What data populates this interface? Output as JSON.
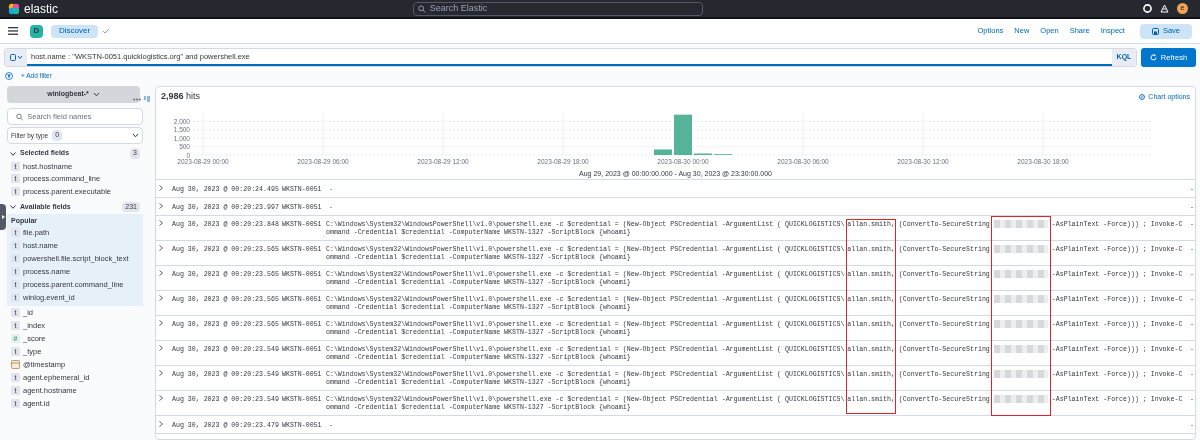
{
  "top_bar": {
    "brand": "elastic",
    "search_placeholder": "Search Elastic",
    "avatar": "e"
  },
  "app_bar": {
    "space": "D",
    "breadcrumb": "Discover",
    "actions": [
      "Options",
      "New",
      "Open",
      "Share",
      "Inspect"
    ],
    "save": "Save"
  },
  "query": {
    "value": "host.name : \"WKSTN-0051.quicklogistics.org\" and powershell.exe",
    "language": "KQL",
    "refresh": "Refresh"
  },
  "add_filter": "+ Add filter",
  "sidebar": {
    "index_pattern": "winlogbeat-*",
    "search_placeholder": "Search field names",
    "filter_by_type": "Filter by type",
    "filter_count": "0",
    "selected_header": "Selected fields",
    "selected_count": "3",
    "selected_fields": [
      {
        "name": "host.hostname",
        "kind": "string",
        "icon": "t"
      },
      {
        "name": "process.command_line",
        "kind": "string",
        "icon": "t"
      },
      {
        "name": "process.parent.executable",
        "kind": "string",
        "icon": "t"
      }
    ],
    "available_header": "Available fields",
    "available_count": "231",
    "popular_header": "Popular",
    "popular_fields": [
      {
        "name": "file.path",
        "kind": "string",
        "icon": "t"
      },
      {
        "name": "host.name",
        "kind": "string",
        "icon": "t"
      },
      {
        "name": "powershell.file.script_block_text",
        "kind": "string",
        "icon": "t"
      },
      {
        "name": "process.name",
        "kind": "string",
        "icon": "t"
      },
      {
        "name": "process.parent.command_line",
        "kind": "string",
        "icon": "t"
      },
      {
        "name": "winlog.event_id",
        "kind": "string",
        "icon": "t"
      }
    ],
    "other_fields": [
      {
        "name": "_id",
        "kind": "string",
        "icon": "t"
      },
      {
        "name": "_index",
        "kind": "string",
        "icon": "t"
      },
      {
        "name": "_score",
        "kind": "number",
        "icon": "#"
      },
      {
        "name": "_type",
        "kind": "string",
        "icon": "t"
      },
      {
        "name": "@timestamp",
        "kind": "date"
      },
      {
        "name": "agent.ephemeral_id",
        "kind": "string",
        "icon": "t"
      },
      {
        "name": "agent.hostname",
        "kind": "string",
        "icon": "t"
      },
      {
        "name": "agent.id",
        "kind": "string",
        "icon": "t"
      }
    ]
  },
  "hits": {
    "count": "2,986",
    "label": "hits"
  },
  "chart_options": "Chart options",
  "histogram": {
    "time_range": "Aug 29, 2023 @ 00:00:00.000 - Aug 30, 2023 @ 23:30:00.000",
    "chart_data": {
      "type": "bar",
      "grid": true,
      "categories": [
        "2023-08-29 00:00",
        null,
        null,
        null,
        null,
        null,
        "2023-08-29 06:00",
        null,
        null,
        null,
        null,
        null,
        "2023-08-29 12:00",
        null,
        null,
        null,
        null,
        null,
        "2023-08-29 18:00",
        null,
        null,
        null,
        null,
        null,
        "2023-08-30 00:00",
        null,
        null,
        null,
        null,
        null,
        "2023-08-30 06:00",
        null,
        null,
        null,
        null,
        null,
        "2023-08-30 12:00",
        null,
        null,
        null,
        null,
        null,
        "2023-08-30 18:00",
        null,
        null,
        null,
        null,
        null
      ],
      "series": [
        {
          "color": "#54b399",
          "values": [
            null,
            null,
            null,
            null,
            null,
            null,
            null,
            null,
            null,
            null,
            null,
            null,
            null,
            null,
            null,
            null,
            null,
            null,
            null,
            null,
            null,
            null,
            null,
            330,
            2400,
            90,
            50,
            null,
            null,
            null,
            null,
            null,
            null,
            null,
            null,
            null,
            null,
            null,
            null,
            null,
            null,
            null,
            null,
            null,
            null,
            null,
            null,
            null
          ]
        }
      ],
      "ylim": [
        0,
        2500
      ],
      "yticks": [
        0,
        500,
        {
          "value": 1000,
          "label": "1,000"
        },
        {
          "value": 1500,
          "label": "1,500"
        },
        {
          "value": 2000,
          "label": "2,000"
        }
      ]
    }
  },
  "rows": [
    {
      "kind": "empty",
      "time": "Aug 30, 2023 @ 00:20:24.495",
      "host": "WKSTN-0051",
      "command": "-",
      "last": "-"
    },
    {
      "kind": "empty",
      "time": "Aug 30, 2023 @ 00:20:23.997",
      "host": "WKSTN-0051",
      "command": "-",
      "last": "-"
    },
    {
      "kind": "command",
      "time": "Aug 30, 2023 @ 00:20:23.848",
      "host": "WKSTN-0051",
      "command": {
        "before_user": "C:\\Windows\\System32\\WindowsPowerShell\\v1.0\\powershell.exe -c $credential = (New-Object PSCredential -ArgumentList ( QUICKLOGISTICS\\",
        "user": "allan.smith,",
        "middle": " (ConvertTo-SecureString",
        "after_secret": "-AsPlainText -Force))) ; Invoke-C",
        "line_2": "ommand -Credential $credential -ComputerName WKSTN-1327 -ScriptBlock {whoami}"
      },
      "last": "-"
    },
    {
      "kind": "command",
      "time": "Aug 30, 2023 @ 00:20:23.565",
      "host": "WKSTN-0051",
      "command": {
        "before_user": "C:\\Windows\\System32\\WindowsPowerShell\\v1.0\\powershell.exe -c $credential = (New-Object PSCredential -ArgumentList ( QUICKLOGISTICS\\",
        "user": "allan.smith,",
        "middle": " (ConvertTo-SecureString",
        "after_secret": "-AsPlainText -Force))) ; Invoke-C",
        "line_2": "ommand -Credential $credential -ComputerName WKSTN-1327 -ScriptBlock {whoami}"
      },
      "last": "-"
    },
    {
      "kind": "command",
      "time": "Aug 30, 2023 @ 00:20:23.565",
      "host": "WKSTN-0051",
      "command": {
        "before_user": "C:\\Windows\\System32\\WindowsPowerShell\\v1.0\\powershell.exe -c $credential = (New-Object PSCredential -ArgumentList ( QUICKLOGISTICS\\",
        "user": "allan.smith,",
        "middle": " (ConvertTo-SecureString",
        "after_secret": "-AsPlainText -Force))) ; Invoke-C",
        "line_2": "ommand -Credential $credential -ComputerName WKSTN-1327 -ScriptBlock {whoami}"
      },
      "last": "-"
    },
    {
      "kind": "command",
      "time": "Aug 30, 2023 @ 00:20:23.565",
      "host": "WKSTN-0051",
      "command": {
        "before_user": "C:\\Windows\\System32\\WindowsPowerShell\\v1.0\\powershell.exe -c $credential = (New-Object PSCredential -ArgumentList ( QUICKLOGISTICS\\",
        "user": "allan.smith,",
        "middle": " (ConvertTo-SecureString",
        "after_secret": "-AsPlainText -Force))) ; Invoke-C",
        "line_2": "ommand -Credential $credential -ComputerName WKSTN-1327 -ScriptBlock {whoami}"
      },
      "last": "-"
    },
    {
      "kind": "command",
      "time": "Aug 30, 2023 @ 00:20:23.565",
      "host": "WKSTN-0051",
      "command": {
        "before_user": "C:\\Windows\\System32\\WindowsPowerShell\\v1.0\\powershell.exe -c $credential = (New-Object PSCredential -ArgumentList ( QUICKLOGISTICS\\",
        "user": "allan.smith,",
        "middle": " (ConvertTo-SecureString",
        "after_secret": "-AsPlainText -Force))) ; Invoke-C",
        "line_2": "ommand -Credential $credential -ComputerName WKSTN-1327 -ScriptBlock {whoami}"
      },
      "last": "-"
    },
    {
      "kind": "command",
      "time": "Aug 30, 2023 @ 00:20:23.549",
      "host": "WKSTN-0051",
      "command": {
        "before_user": "C:\\Windows\\System32\\WindowsPowerShell\\v1.0\\powershell.exe -c $credential = (New-Object PSCredential -ArgumentList ( QUICKLOGISTICS\\",
        "user": "allan.smith,",
        "middle": " (ConvertTo-SecureString",
        "after_secret": "-AsPlainText -Force))) ; Invoke-C",
        "line_2": "ommand -Credential $credential -ComputerName WKSTN-1327 -ScriptBlock {whoami}"
      },
      "last": "-"
    },
    {
      "kind": "command",
      "time": "Aug 30, 2023 @ 00:20:23.549",
      "host": "WKSTN-0051",
      "command": {
        "before_user": "C:\\Windows\\System32\\WindowsPowerShell\\v1.0\\powershell.exe -c $credential = (New-Object PSCredential -ArgumentList ( QUICKLOGISTICS\\",
        "user": "allan.smith,",
        "middle": " (ConvertTo-SecureString",
        "after_secret": "-AsPlainText -Force))) ; Invoke-C",
        "line_2": "ommand -Credential $credential -ComputerName WKSTN-1327 -ScriptBlock {whoami}"
      },
      "last": "-"
    },
    {
      "kind": "command",
      "time": "Aug 30, 2023 @ 00:20:23.549",
      "host": "WKSTN-0051",
      "command": {
        "before_user": "C:\\Windows\\System32\\WindowsPowerShell\\v1.0\\powershell.exe -c $credential = (New-Object PSCredential -ArgumentList ( QUICKLOGISTICS\\",
        "user": "allan.smith,",
        "middle": " (ConvertTo-SecureString",
        "after_secret": "-AsPlainText -Force))) ; Invoke-C",
        "line_2": "ommand -Credential $credential -ComputerName WKSTN-1327 -ScriptBlock {whoami}"
      },
      "last": "-"
    },
    {
      "kind": "empty",
      "time": "Aug 30, 2023 @ 00:20:23.479",
      "host": "WKSTN-0051",
      "command": "-",
      "last": "-"
    }
  ],
  "annotation": {
    "user_boxed": true,
    "secret_boxed": true
  }
}
